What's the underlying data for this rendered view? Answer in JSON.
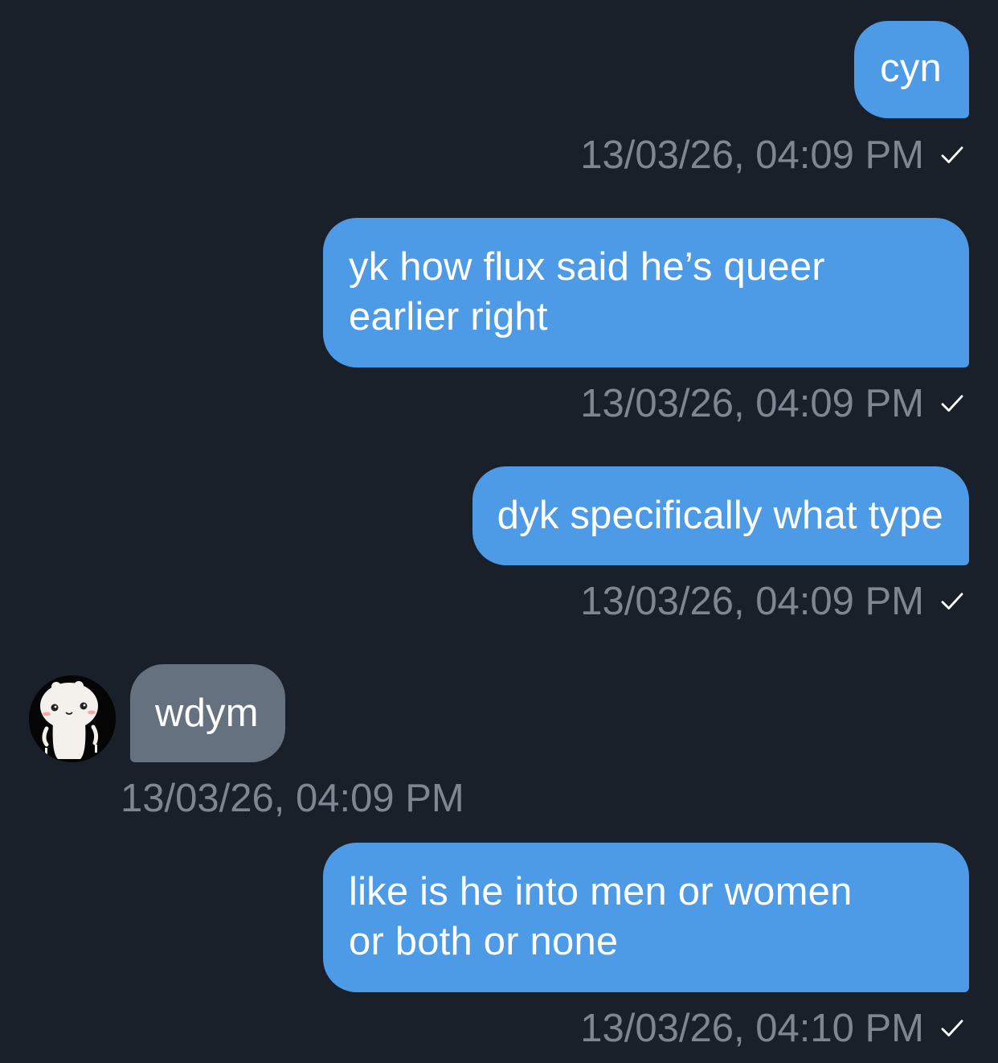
{
  "messages": [
    {
      "text": "cyn",
      "time": "13/03/26, 04:09 PM",
      "status": "sent-check-icon"
    },
    {
      "text_lines": [
        "yk how flux said he’s queer",
        "earlier right"
      ],
      "time": "13/03/26, 04:09 PM",
      "status": "sent-check-icon"
    },
    {
      "text": "dyk specifically what type",
      "time": "13/03/26, 04:09 PM",
      "status": "sent-check-icon"
    },
    {
      "text": "wdym",
      "time": "13/03/26, 04:09 PM",
      "sender_avatar": "bear-avatar-icon"
    },
    {
      "text_lines": [
        "like is he into men or women",
        "or both or none"
      ],
      "time": "13/03/26, 04:10 PM",
      "status": "sent-check-icon"
    }
  ],
  "colors": {
    "background": "#19202a",
    "outgoing_bubble": "#4d9be6",
    "incoming_bubble": "#66717f",
    "timestamp": "#7e8691",
    "text": "#ffffff"
  }
}
